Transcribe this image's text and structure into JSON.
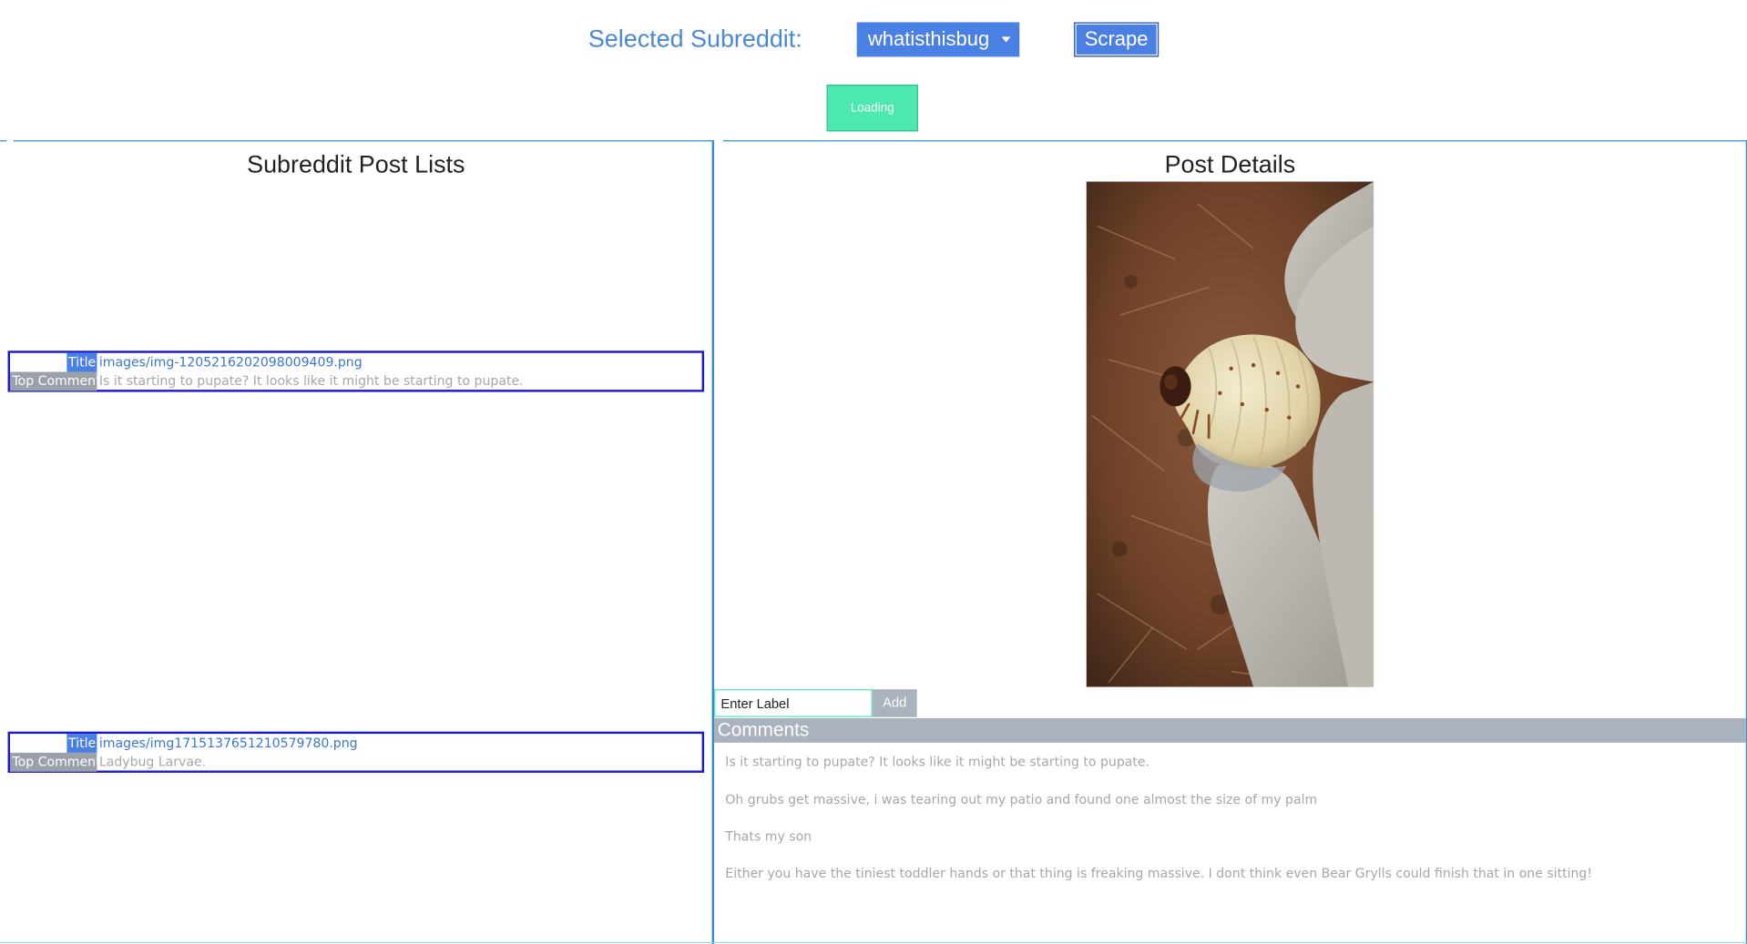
{
  "header": {
    "selected_label": "Selected Subreddit:",
    "subreddit_value": "whatisthisbug",
    "scrape_label": "Scrape",
    "loading_label": "Loading"
  },
  "post_list": {
    "title": "Subreddit Post Lists",
    "posts": [
      {
        "title_tag": "Title",
        "title": "images/img-1205216202098009409.png",
        "comment_tag": "Top Comment",
        "top_comment": "Is it starting to pupate? It looks like it might be starting to pupate."
      },
      {
        "title_tag": "Title",
        "title": "images/img1715137651210579780.png",
        "comment_tag": "Top Comment",
        "top_comment": "Ladybug Larvae."
      }
    ]
  },
  "details": {
    "title": "Post Details",
    "label_placeholder": "Enter Label",
    "add_label": "Add",
    "comments_header": "Comments",
    "comments": [
      "Is it starting to pupate? It looks like it might be starting to pupate.",
      "Oh grubs get massive, i was tearing out my patio and found one almost the size of my palm",
      "Thats my son",
      "Either you have the tiniest toddler hands or that thing is freaking massive. I dont think even Bear Grylls could finish that in one sitting!"
    ]
  },
  "colors": {
    "accent": "#4a80e4",
    "loading": "#4de8b0",
    "card_border": "#1a1ad0",
    "panel_border": "#2f8fc6",
    "muted": "#aab3bd"
  }
}
